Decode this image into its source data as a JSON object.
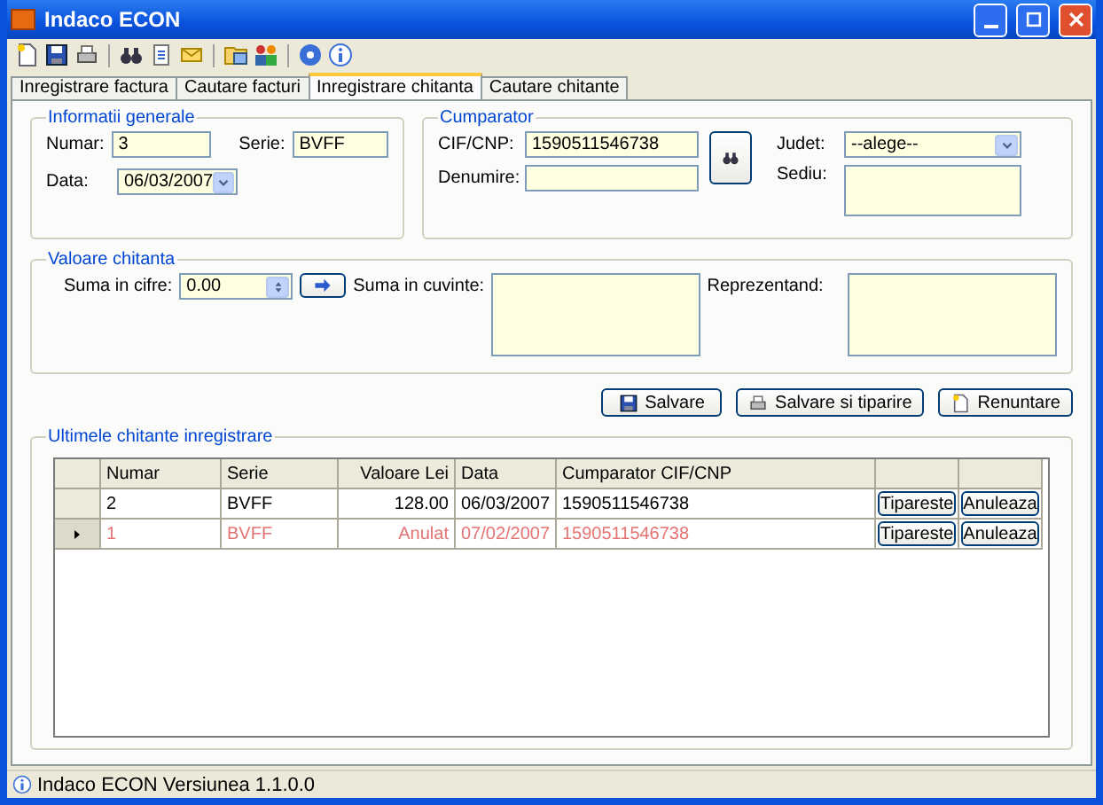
{
  "window": {
    "title": "Indaco ECON"
  },
  "tabs": [
    {
      "label": "Inregistrare factura",
      "selected": false
    },
    {
      "label": "Cautare facturi",
      "selected": false
    },
    {
      "label": "Inregistrare chitanta",
      "selected": true
    },
    {
      "label": "Cautare chitante",
      "selected": false
    }
  ],
  "general": {
    "title": "Informatii generale",
    "numar": {
      "label": "Numar:",
      "value": "3"
    },
    "serie": {
      "label": "Serie:",
      "value": "BVFF"
    },
    "data": {
      "label": "Data:",
      "value": "06/03/2007"
    }
  },
  "buyer": {
    "title": "Cumparator",
    "cif": {
      "label": "CIF/CNP:",
      "value": "1590511546738"
    },
    "denumire": {
      "label": "Denumire:"
    },
    "judet": {
      "label": "Judet:",
      "value": "--alege--"
    },
    "sediu": {
      "label": "Sediu:"
    }
  },
  "amount": {
    "title": "Valoare chitanta",
    "suma_cifre": {
      "label": "Suma in cifre:",
      "value": "0.00"
    },
    "suma_cuvinte": {
      "label": "Suma in cuvinte:"
    },
    "reprezentand": {
      "label": "Reprezentand:"
    }
  },
  "buttons": [
    {
      "label": "Salvare",
      "kind": "save"
    },
    {
      "label": "Salvare si tiparire",
      "kind": "print"
    },
    {
      "label": "Renuntare",
      "kind": "cancel"
    }
  ],
  "recent": {
    "title": "Ultimele chitante inregistrare",
    "columns": [
      "Numar",
      "Serie",
      "Valoare Lei",
      "Data",
      "Cumparator CIF/CNP"
    ],
    "rows": [
      {
        "cells": [
          "2",
          "BVFF",
          "128.00",
          "06/03/2007",
          "1590511546738"
        ],
        "cancelled": false,
        "selected": false,
        "actions": [
          "Tipareste",
          "Anuleaza"
        ]
      },
      {
        "cells": [
          "1",
          "BVFF",
          "Anulat",
          "07/02/2007",
          "1590511546738"
        ],
        "cancelled": true,
        "selected": true,
        "actions": [
          "Tipareste",
          "Anuleaza"
        ]
      }
    ]
  },
  "status_bar": {
    "text": "Indaco ECON Versiunea 1.1.0.0"
  }
}
